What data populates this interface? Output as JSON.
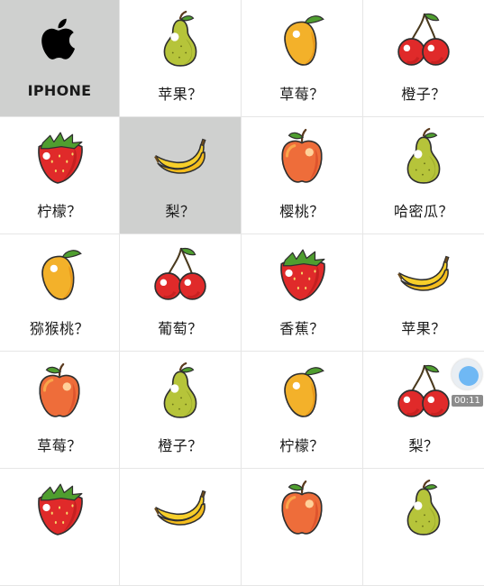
{
  "grid": {
    "cells": [
      {
        "icon": "apple-logo-icon",
        "label": "IPHONE",
        "selected": true
      },
      {
        "icon": "pear-icon",
        "label": "苹果？",
        "selected": false
      },
      {
        "icon": "mango-icon",
        "label": "草莓？",
        "selected": false
      },
      {
        "icon": "cherry-icon",
        "label": "橙子？",
        "selected": false
      },
      {
        "icon": "strawberry-icon",
        "label": "柠檬？",
        "selected": false
      },
      {
        "icon": "banana-icon",
        "label": "梨？",
        "selected": true
      },
      {
        "icon": "apple-icon",
        "label": "樱桃？",
        "selected": false
      },
      {
        "icon": "pear-icon",
        "label": "哈密瓜？",
        "selected": false
      },
      {
        "icon": "mango-icon",
        "label": "猕猴桃？",
        "selected": false
      },
      {
        "icon": "cherry-icon",
        "label": "葡萄？",
        "selected": false
      },
      {
        "icon": "strawberry-icon",
        "label": "香蕉？",
        "selected": false
      },
      {
        "icon": "banana-icon",
        "label": "苹果？",
        "selected": false
      },
      {
        "icon": "apple-icon",
        "label": "草莓？",
        "selected": false
      },
      {
        "icon": "pear-icon",
        "label": "橙子？",
        "selected": false
      },
      {
        "icon": "mango-icon",
        "label": "柠檬？",
        "selected": false
      },
      {
        "icon": "cherry-icon",
        "label": "梨？",
        "selected": false
      },
      {
        "icon": "strawberry-icon",
        "label": "",
        "selected": false
      },
      {
        "icon": "banana-icon",
        "label": "",
        "selected": false
      },
      {
        "icon": "apple-icon",
        "label": "",
        "selected": false
      },
      {
        "icon": "pear-icon",
        "label": "",
        "selected": false
      }
    ]
  },
  "recorder": {
    "time": "00:11",
    "accent": "#6fb8f4"
  },
  "colors": {
    "selected_bg": "#cfd0cf",
    "divider": "#e6e6e6"
  }
}
